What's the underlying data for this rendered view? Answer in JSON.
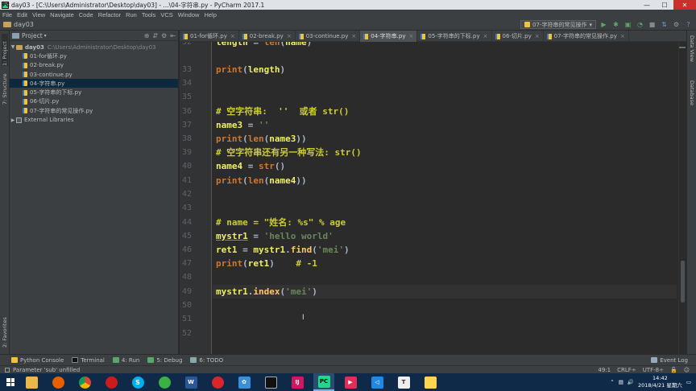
{
  "window": {
    "title": "day03 - [C:\\Users\\Administrator\\Desktop\\day03] - ...\\04-字符串.py - PyCharm 2017.1",
    "minimize": "—",
    "maximize": "☐",
    "close": "✕"
  },
  "menu": [
    "File",
    "Edit",
    "View",
    "Navigate",
    "Code",
    "Refactor",
    "Run",
    "Tools",
    "VCS",
    "Window",
    "Help"
  ],
  "navbar": {
    "breadcrumb": "day03",
    "run_config": "07-字符串的常见操作"
  },
  "left_strip": {
    "project_label": "1: Project",
    "structure_label": "7: Structure",
    "favorites_label": "2: Favorites"
  },
  "right_strip": {
    "data_view": "Data View",
    "database": "Database"
  },
  "project_panel": {
    "header": "Project",
    "root_name": "day03",
    "root_path": "C:\\Users\\Administrator\\Desktop\\day03",
    "files": [
      "01-for循环.py",
      "02-break.py",
      "03-continue.py",
      "04-字符串.py",
      "05-字符串的下标.py",
      "06-切片.py",
      "07-字符串的常见操作.py"
    ],
    "selected_file": "04-字符串.py",
    "external": "External Libraries"
  },
  "tabs": [
    {
      "label": "01-for循环.py",
      "active": false
    },
    {
      "label": "02-break.py",
      "active": false
    },
    {
      "label": "03-continue.py",
      "active": false
    },
    {
      "label": "04-字符串.py",
      "active": true
    },
    {
      "label": "05-字符串的下标.py",
      "active": false
    },
    {
      "label": "06-切片.py",
      "active": false
    },
    {
      "label": "07-字符串的常见操作.py",
      "active": false
    }
  ],
  "editor": {
    "line_numbers": [
      "32",
      "33",
      "34",
      "35",
      "36",
      "37",
      "38",
      "39",
      "40",
      "41",
      "42",
      "43",
      "44",
      "45",
      "46",
      "47",
      "48",
      "49",
      "50",
      "51",
      "52"
    ],
    "caret_line": "49"
  },
  "toolwindows": {
    "python_console": "Python Console",
    "terminal": "Terminal",
    "run": "4: Run",
    "debug": "5: Debug",
    "todo": "6: TODO",
    "event_log": "Event Log"
  },
  "status": {
    "message": "Parameter 'sub' unfilled",
    "position": "49:1",
    "line_sep": "CRLF÷",
    "encoding": "UTF-8÷"
  },
  "taskbar": {
    "time": "14:42",
    "date": "2018/4/21 星期六"
  }
}
